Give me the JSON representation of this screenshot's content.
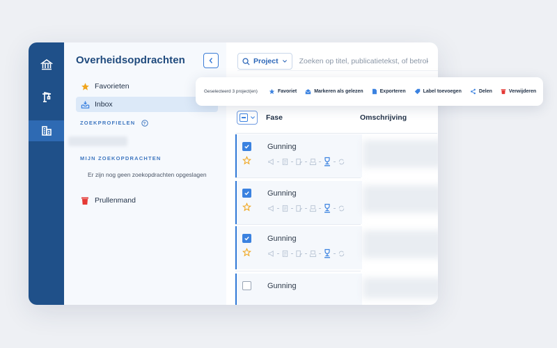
{
  "app": {
    "title": "Overheidsopdrachten"
  },
  "sidebar": {
    "items": [
      {
        "label": "Favorieten",
        "icon": "star-icon"
      },
      {
        "label": "Inbox",
        "icon": "inbox-icon"
      }
    ],
    "zoekprofielen_label": "ZOEKPROFIELEN",
    "mijn_zoekopdrachten_label": "MIJN ZOEKOPDRACHTEN",
    "empty_note": "Er zijn nog geen zoekopdrachten opgeslagen",
    "trash_label": "Prullenmand"
  },
  "search": {
    "scope": "Project",
    "placeholder": "Zoeken op titel, publicatietekst, of betrokkenen"
  },
  "table": {
    "columns": [
      "Fase",
      "Omschrijving"
    ],
    "rows": [
      {
        "phase": "Gunning",
        "checked": true
      },
      {
        "phase": "Gunning",
        "checked": true
      },
      {
        "phase": "Gunning",
        "checked": true
      },
      {
        "phase": "Gunning",
        "checked": false
      }
    ]
  },
  "toolbar": {
    "selection_count": "Geselecteerd 3 project(en)",
    "actions": [
      {
        "label": "Favoriet",
        "icon": "star-icon"
      },
      {
        "label": "Markeren als gelezen",
        "icon": "envelope-open-icon"
      },
      {
        "label": "Exporteren",
        "icon": "document-icon"
      },
      {
        "label": "Label toevoegen",
        "icon": "tag-icon"
      },
      {
        "label": "Delen",
        "icon": "share-icon"
      },
      {
        "label": "Verwijderen",
        "icon": "trash-icon"
      }
    ]
  },
  "colors": {
    "rail": "#1f5089",
    "accent": "#3b82e0",
    "title": "#1f4a7d",
    "star": "#f0a51d",
    "danger": "#e53935"
  }
}
